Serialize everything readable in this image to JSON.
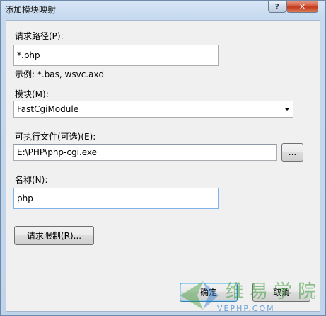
{
  "window": {
    "title": "添加模块映射"
  },
  "titlebar": {
    "help_glyph": "?",
    "close_glyph": "✕"
  },
  "request_path": {
    "label": "请求路径(P):",
    "value": "*.php",
    "example": "示例: *.bas, wsvc.axd"
  },
  "module": {
    "label": "模块(M):",
    "selected": "FastCgiModule"
  },
  "executable": {
    "label": "可执行文件(可选)(E):",
    "value": "E:\\PHP\\php-cgi.exe",
    "browse_label": "..."
  },
  "name": {
    "label": "名称(N):",
    "value": "php"
  },
  "buttons": {
    "restrictions": "请求限制(R)...",
    "ok": "确定",
    "cancel": "取消"
  },
  "watermark": {
    "text": "维易学院",
    "sub": "VEPHP.COM"
  },
  "colors": {
    "accent": "#3c7fb1",
    "close": "#c33a1c",
    "watermark_green": "#3d9c3a",
    "watermark_blue": "#2f7fd0"
  }
}
